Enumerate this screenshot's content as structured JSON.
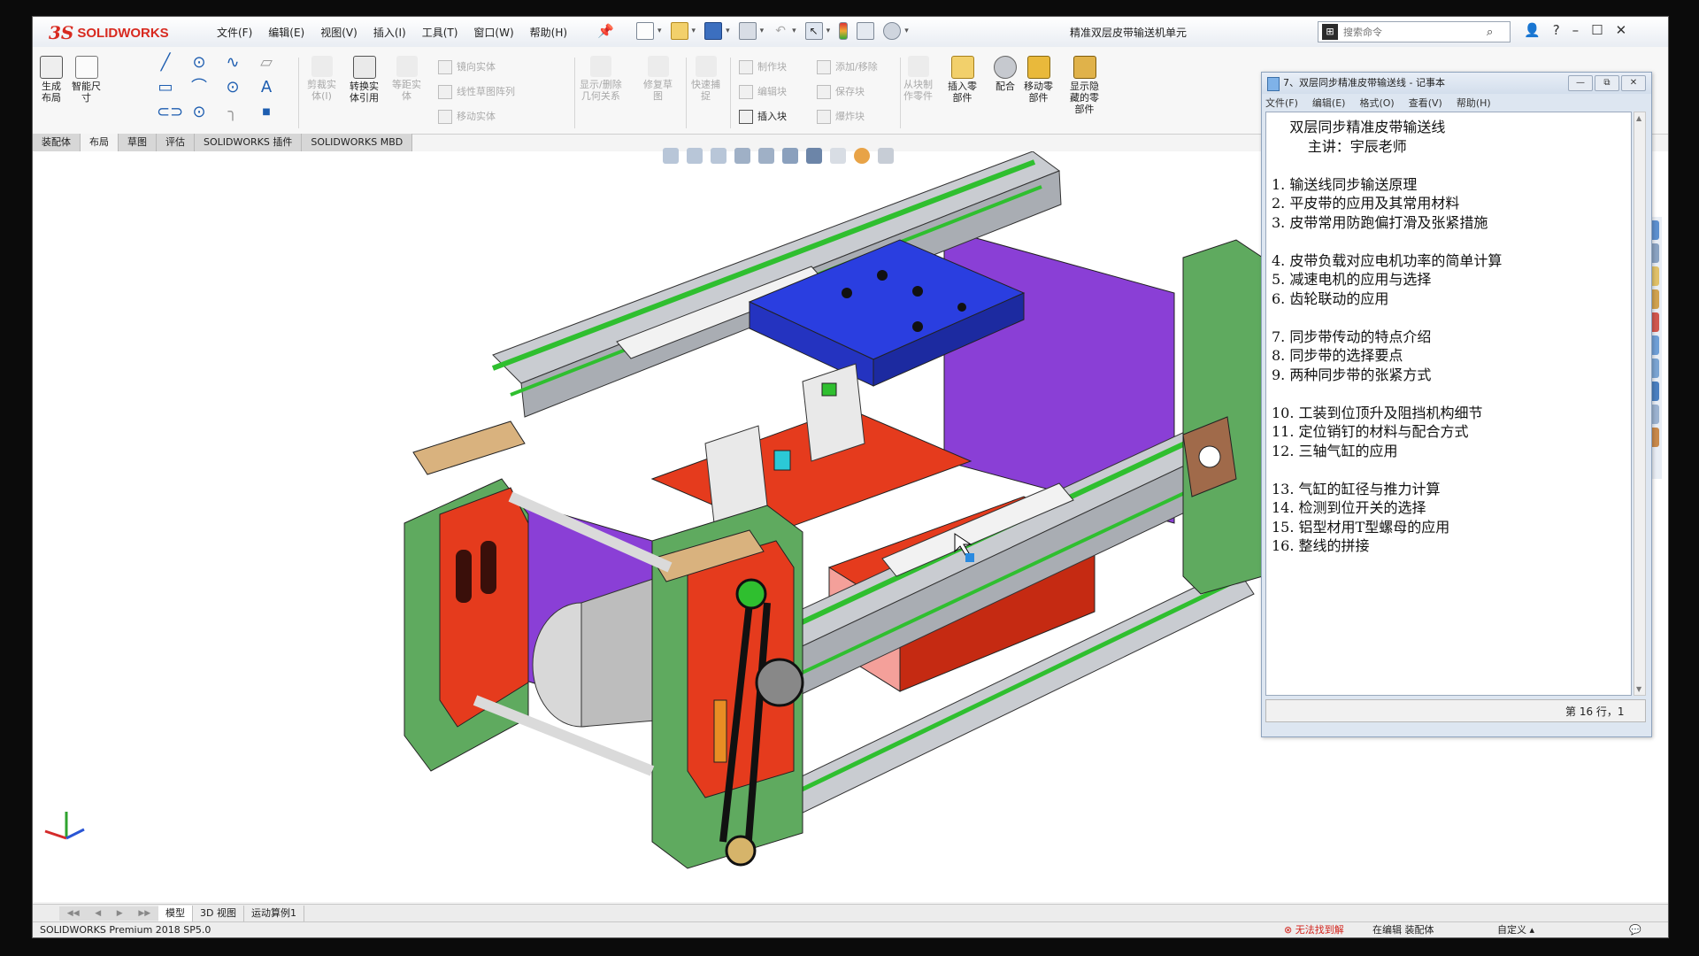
{
  "app": {
    "logo_ds": "3S",
    "logo_name": "SOLIDWORKS",
    "menus": [
      "文件(F)",
      "编辑(E)",
      "视图(V)",
      "插入(I)",
      "工具(T)",
      "窗口(W)",
      "帮助(H)"
    ],
    "document_title": "精准双层皮带输送机单元",
    "search_placeholder": "搜索命令"
  },
  "commands": {
    "generate_layout": "生成\n布局",
    "smart_dim": "智能尺\n寸",
    "cut_body": "剪裁实\n体(I)",
    "convert_ref": "转换实\n体引用",
    "offset_entity": "等距实\n体",
    "mirror": "镜向实体",
    "linear_pattern": "线性草图阵列",
    "move_entity": "移动实体",
    "display_relations": "显示/删除\n几何关系",
    "repair_sketch": "修复草\n图",
    "quick_snap": "快速捕\n捉",
    "make_block": "制作块",
    "edit_block": "编辑块",
    "insert_block": "插入块",
    "add_remove": "添加/移除",
    "save_block": "保存块",
    "explode_block": "爆炸块",
    "from_part": "从块制\n作零件",
    "insert_part": "插入零\n部件",
    "mate": "配合",
    "move_part": "移动零\n部件",
    "show_hidden": "显示隐\n藏的零\n部件"
  },
  "tabs": [
    "装配体",
    "布局",
    "草图",
    "评估",
    "SOLIDWORKS 插件",
    "SOLIDWORKS MBD"
  ],
  "active_tab": "布局",
  "model_tabs": [
    "模型",
    "3D 视图",
    "运动算例1"
  ],
  "status": {
    "product": "SOLIDWORKS Premium 2018 SP5.0",
    "error": "无法找到解",
    "editing": "在编辑 装配体",
    "custom": "自定义"
  },
  "notepad": {
    "title": "7、双层同步精准皮带输送线 - 记事本",
    "menus": [
      "文件(F)",
      "编辑(E)",
      "格式(O)",
      "查看(V)",
      "帮助(H)"
    ],
    "heading": "    双层同步精准皮带输送线",
    "lecturer": "        主讲：宇辰老师",
    "lines": [
      "1. 输送线同步输送原理",
      "2. 平皮带的应用及其常用材料",
      "3. 皮带常用防跑偏打滑及张紧措施",
      "",
      "4. 皮带负载对应电机功率的简单计算",
      "5. 减速电机的应用与选择",
      "6. 齿轮联动的应用",
      "",
      "7. 同步带传动的特点介绍",
      "8. 同步带的选择要点",
      "9. 两种同步带的张紧方式",
      "",
      "10. 工装到位顶升及阻挡机构细节",
      "11. 定位销钉的材料与配合方式",
      "12. 三轴气缸的应用",
      "",
      "13. 气缸的缸径与推力计算",
      "14. 检测到位开关的选择",
      "15. 铝型材用T型螺母的应用",
      "16. 整线的拼接"
    ],
    "status_text": "第 16 行，1"
  },
  "colors": {
    "brand": "#d82a20",
    "frame_green": "#5faa5f",
    "plate_red": "#e53b1d",
    "plate_blue": "#2a3ee0",
    "plate_purple": "#8a3fd6",
    "profile_gray": "#c9ccd1",
    "belt_green": "#2fbf2f",
    "bearing_wood": "#d9b27e"
  }
}
